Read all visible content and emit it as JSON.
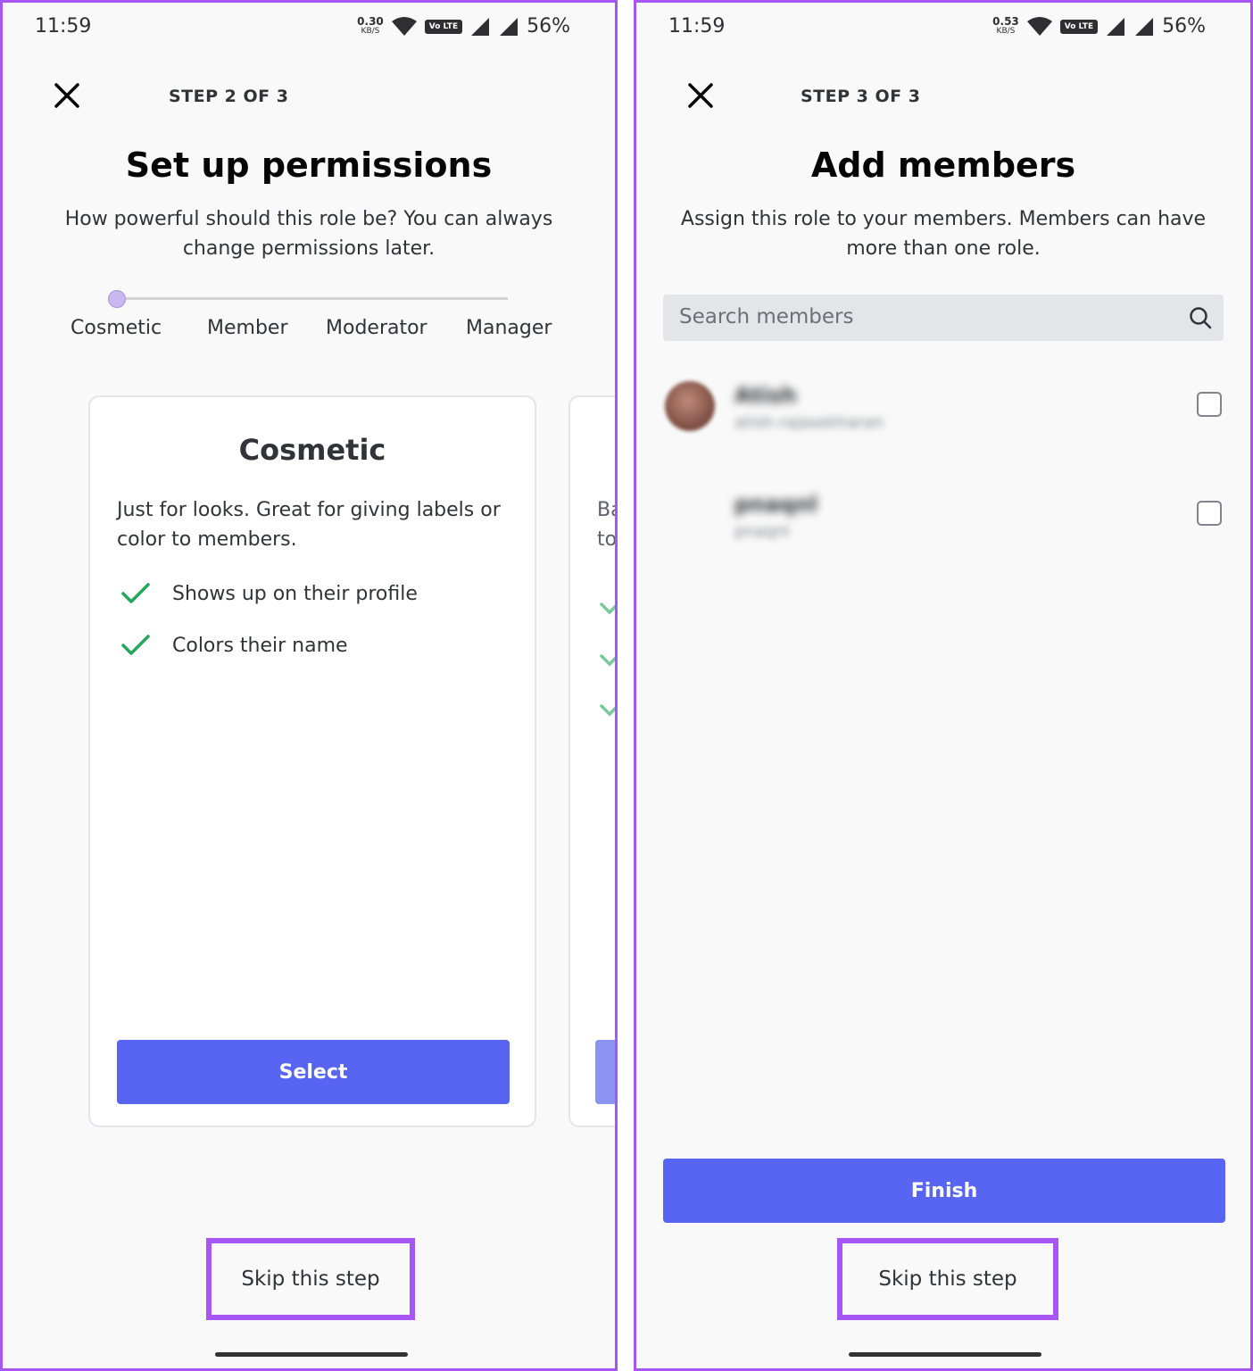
{
  "status": {
    "time": "11:59",
    "battery": "56%",
    "speed_left": "0.30",
    "speed_right": "0.53",
    "speed_unit": "KB/S",
    "lte": "Vo LTE"
  },
  "screen1": {
    "step": "STEP 2 OF 3",
    "title": "Set up permissions",
    "subtitle": "How powerful should this role be? You can always change permissions later.",
    "levels": [
      "Cosmetic",
      "Member",
      "Moderator",
      "Manager"
    ],
    "selected_level": "Cosmetic",
    "card": {
      "title": "Cosmetic",
      "description": "Just for looks. Great for giving labels or color to members.",
      "features": [
        "Shows up on their profile",
        "Colors their name"
      ],
      "button": "Select"
    },
    "peek_text": "Ba\nto",
    "skip": "Skip this step"
  },
  "screen2": {
    "step": "STEP 3 OF 3",
    "title": "Add members",
    "subtitle": "Assign this role to your members. Members can have more than one role.",
    "search_placeholder": "Search members",
    "members": [
      {
        "name": "Atish",
        "username": "atish.rajasekharan"
      },
      {
        "name": "pnaqnl",
        "username": "pnaqnl"
      }
    ],
    "finish": "Finish",
    "skip": "Skip this step"
  },
  "colors": {
    "accent": "#5865f2",
    "highlight": "#a855f7",
    "check": "#23a55a"
  }
}
